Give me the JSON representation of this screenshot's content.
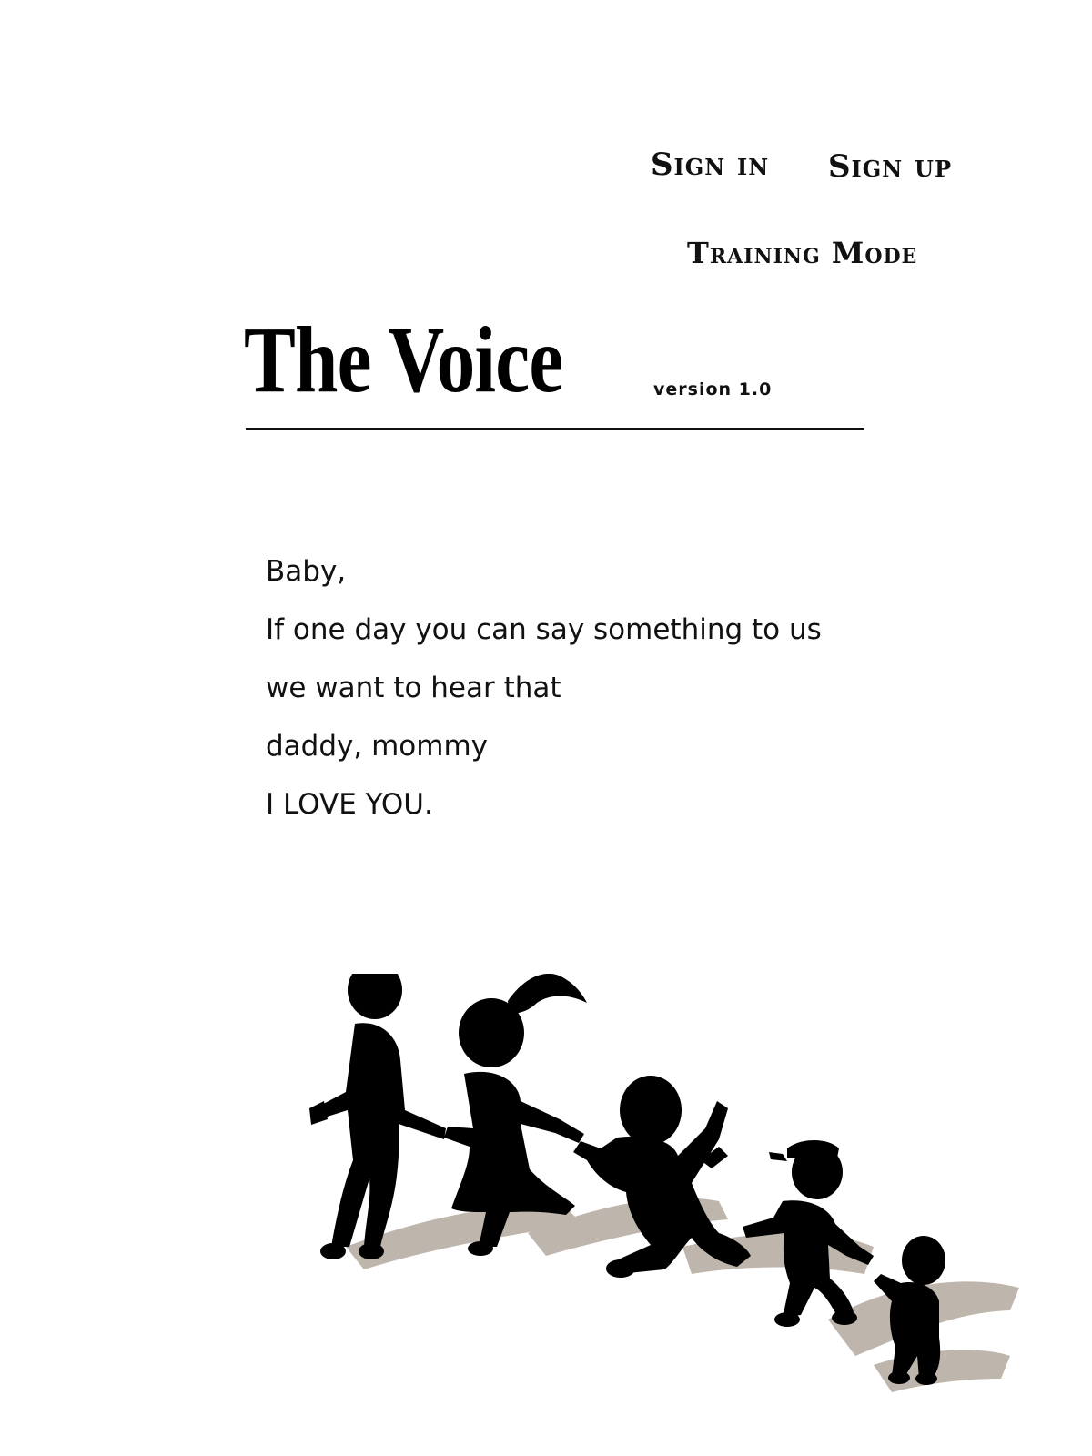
{
  "nav": {
    "sign_in": "Sign in",
    "sign_up": "Sign up",
    "training_mode": "Training Mode"
  },
  "header": {
    "title": "The Voice",
    "version": "version 1.0"
  },
  "message": {
    "lines": [
      "Baby,",
      "If one day you can say something to us",
      "we want to hear that",
      "daddy, mommy",
      "I LOVE YOU."
    ]
  },
  "colors": {
    "text": "#111111",
    "silhouette": "#000000",
    "shadow": "#b3a99e",
    "background": "#ffffff"
  },
  "illustration": {
    "icon": "children-silhouette-icon"
  }
}
